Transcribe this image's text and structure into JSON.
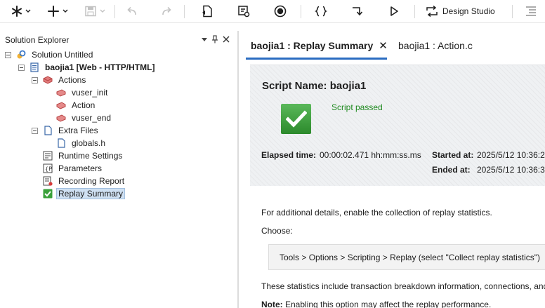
{
  "toolbar": {
    "design_studio_label": "Design Studio",
    "icons": [
      "asterisk-icon",
      "plus-icon",
      "save-icon",
      "undo-icon",
      "redo-icon",
      "script-icon",
      "runtime-icon",
      "record-icon",
      "braces-icon",
      "step-icon",
      "play-icon",
      "design-studio-icon",
      "list-icon"
    ]
  },
  "solution_explorer": {
    "title": "Solution Explorer",
    "tree": {
      "solution": "Solution Untitled",
      "script": "baojia1 [Web - HTTP/HTML]",
      "actions": "Actions",
      "vuser_init": "vuser_init",
      "action": "Action",
      "vuser_end": "vuser_end",
      "extra_files": "Extra Files",
      "globals": "globals.h",
      "runtime_settings": "Runtime Settings",
      "parameters": "Parameters",
      "recording_report": "Recording Report",
      "replay_summary": "Replay Summary"
    }
  },
  "tabs": {
    "active": "baojia1 : Replay Summary",
    "close": "✕",
    "inactive": "baojia1 : Action.c"
  },
  "summary": {
    "script_name": "Script Name: baojia1",
    "status": "Script passed",
    "elapsed_label": "Elapsed time:",
    "elapsed_value": "00:00:02.471 hh:mm:ss.ms",
    "started_label": "Started at:",
    "started_value": "2025/5/12 10:36:2",
    "ended_label": "Ended at:",
    "ended_value": "2025/5/12 10:36:3"
  },
  "details": {
    "line1": "For additional details, enable the collection of replay statistics.",
    "choose": "Choose:",
    "command": "Tools > Options > Scripting > Replay (select \"Collect replay statistics\")",
    "line2": "These statistics include transaction breakdown information, connections, and",
    "note_label": "Note:",
    "note_text": " Enabling this option may affect the replay performance."
  },
  "colors": {
    "accent": "#2a6cc1",
    "pass_green": "#1f8a1f",
    "selection": "#cfe0f2"
  }
}
